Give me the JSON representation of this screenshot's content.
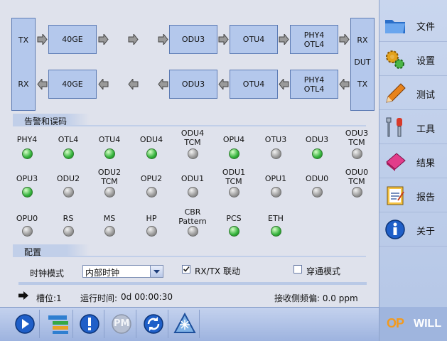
{
  "diagram": {
    "tx_label": "TX",
    "rx_label": "RX",
    "dut_rx": "RX",
    "dut_label": "DUT",
    "dut_tx": "TX",
    "top_row": [
      "40GE",
      "ODU3",
      "OTU4",
      "PHY4\nOTL4"
    ],
    "bottom_row": [
      "40GE",
      "ODU3",
      "OTU4",
      "PHY4\nOTL4"
    ]
  },
  "alarm_section": {
    "title": "告警和误码"
  },
  "alarms": [
    {
      "label": "PHY4",
      "state": "green"
    },
    {
      "label": "OTL4",
      "state": "green"
    },
    {
      "label": "OTU4",
      "state": "green"
    },
    {
      "label": "ODU4",
      "state": "green"
    },
    {
      "label": "ODU4\nTCM",
      "state": "gray"
    },
    {
      "label": "OPU4",
      "state": "green"
    },
    {
      "label": "OTU3",
      "state": "gray"
    },
    {
      "label": "ODU3",
      "state": "green"
    },
    {
      "label": "ODU3\nTCM",
      "state": "gray"
    },
    {
      "label": "OPU3",
      "state": "green"
    },
    {
      "label": "ODU2",
      "state": "gray"
    },
    {
      "label": "ODU2\nTCM",
      "state": "gray"
    },
    {
      "label": "OPU2",
      "state": "gray"
    },
    {
      "label": "ODU1",
      "state": "gray"
    },
    {
      "label": "ODU1\nTCM",
      "state": "gray"
    },
    {
      "label": "OPU1",
      "state": "gray"
    },
    {
      "label": "ODU0",
      "state": "gray"
    },
    {
      "label": "ODU0\nTCM",
      "state": "gray"
    },
    {
      "label": "OPU0",
      "state": "gray"
    },
    {
      "label": "RS",
      "state": "gray"
    },
    {
      "label": "MS",
      "state": "gray"
    },
    {
      "label": "HP",
      "state": "gray"
    },
    {
      "label": "CBR\nPattern",
      "state": "gray"
    },
    {
      "label": "PCS",
      "state": "green"
    },
    {
      "label": "ETH",
      "state": "green"
    }
  ],
  "config": {
    "title": "配置",
    "clock_mode_label": "时钟模式",
    "clock_mode_value": "内部时钟",
    "rxtx_link_label": "RX/TX 联动",
    "rxtx_link_checked": true,
    "passthrough_label": "穿通模式",
    "passthrough_checked": false
  },
  "status": {
    "slot": "槽位:1",
    "runtime_label": "运行时间:",
    "runtime_value": "0d  00:00:30",
    "freq_offset": "接收侧频偏: 0.0 ppm"
  },
  "sidebar": {
    "items": [
      {
        "label": "文件",
        "icon": "folder-icon"
      },
      {
        "label": "设置",
        "icon": "gears-icon"
      },
      {
        "label": "测试",
        "icon": "pencil-icon"
      },
      {
        "label": "工具",
        "icon": "tools-icon"
      },
      {
        "label": "结果",
        "icon": "eraser-icon"
      },
      {
        "label": "报告",
        "icon": "report-icon"
      },
      {
        "label": "关于",
        "icon": "info-icon"
      }
    ]
  },
  "toolbar": {
    "pm_label": "PM",
    "icons": [
      "play-icon",
      "list-icon",
      "alert-icon",
      "pm-icon",
      "refresh-icon",
      "laser-icon"
    ]
  },
  "logo": {
    "op": "OP",
    "will": "WILL"
  },
  "colors": {
    "led_green": "#34b23c",
    "led_gray": "#9a9a9a",
    "box_fill": "#b4c8ec"
  }
}
